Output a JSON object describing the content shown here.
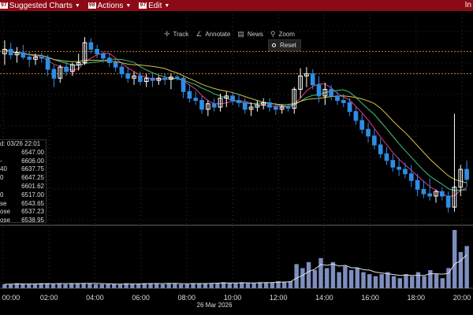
{
  "menubar": {
    "items": [
      {
        "num": "97",
        "label": "Suggested Charts"
      },
      {
        "num": "98",
        "label": "Actions"
      },
      {
        "num": "97",
        "label": "Edit"
      }
    ],
    "right_text": "In"
  },
  "toolbar": {
    "track": "Track",
    "annotate": "Annotate",
    "news": "News",
    "zoom": "Zoom",
    "reset": "Reset"
  },
  "data_panel": {
    "date_label": "d: 03/26 22:01",
    "rows": [
      {
        "label": "",
        "value": "6547.00"
      },
      {
        "label": "-",
        "value": "6606.00"
      },
      {
        "label": "40",
        "value": "6637.75"
      },
      {
        "label": "0",
        "value": "6647.25"
      },
      {
        "label": "",
        "value": "6601.62"
      },
      {
        "label": "0",
        "value": "6517.00"
      },
      {
        "label": "se",
        "value": "6543.65"
      },
      {
        "label": "ose",
        "value": "6537.23"
      },
      {
        "label": "ose",
        "value": "6538.95"
      }
    ]
  },
  "chart_data": {
    "type": "line",
    "date_label": "26 Mar 2026",
    "time_labels": [
      "00:00",
      "02:00",
      "04:00",
      "06:00",
      "08:00",
      "10:00",
      "12:00",
      "14:00",
      "16:00",
      "18:00",
      "20:00"
    ],
    "price_lines": [
      6662,
      6642
    ],
    "candles": [
      {
        "o": 6660,
        "h": 6672,
        "l": 6650,
        "c": 6664
      },
      {
        "o": 6664,
        "h": 6670,
        "l": 6655,
        "c": 6659
      },
      {
        "o": 6659,
        "h": 6666,
        "l": 6652,
        "c": 6661
      },
      {
        "o": 6661,
        "h": 6668,
        "l": 6655,
        "c": 6657
      },
      {
        "o": 6657,
        "h": 6662,
        "l": 6648,
        "c": 6655
      },
      {
        "o": 6655,
        "h": 6660,
        "l": 6650,
        "c": 6657
      },
      {
        "o": 6657,
        "h": 6661,
        "l": 6652,
        "c": 6656
      },
      {
        "o": 6656,
        "h": 6659,
        "l": 6640,
        "c": 6646
      },
      {
        "o": 6646,
        "h": 6650,
        "l": 6630,
        "c": 6638
      },
      {
        "o": 6638,
        "h": 6650,
        "l": 6634,
        "c": 6648
      },
      {
        "o": 6648,
        "h": 6654,
        "l": 6640,
        "c": 6644
      },
      {
        "o": 6644,
        "h": 6652,
        "l": 6640,
        "c": 6650
      },
      {
        "o": 6650,
        "h": 6660,
        "l": 6645,
        "c": 6652
      },
      {
        "o": 6652,
        "h": 6675,
        "l": 6650,
        "c": 6670
      },
      {
        "o": 6670,
        "h": 6674,
        "l": 6660,
        "c": 6664
      },
      {
        "o": 6664,
        "h": 6668,
        "l": 6656,
        "c": 6660
      },
      {
        "o": 6660,
        "h": 6662,
        "l": 6652,
        "c": 6656
      },
      {
        "o": 6656,
        "h": 6660,
        "l": 6648,
        "c": 6652
      },
      {
        "o": 6652,
        "h": 6655,
        "l": 6644,
        "c": 6648
      },
      {
        "o": 6648,
        "h": 6652,
        "l": 6638,
        "c": 6642
      },
      {
        "o": 6642,
        "h": 6648,
        "l": 6634,
        "c": 6638
      },
      {
        "o": 6638,
        "h": 6644,
        "l": 6632,
        "c": 6640
      },
      {
        "o": 6640,
        "h": 6644,
        "l": 6632,
        "c": 6635
      },
      {
        "o": 6635,
        "h": 6642,
        "l": 6630,
        "c": 6638
      },
      {
        "o": 6638,
        "h": 6642,
        "l": 6630,
        "c": 6636
      },
      {
        "o": 6636,
        "h": 6640,
        "l": 6632,
        "c": 6638
      },
      {
        "o": 6638,
        "h": 6642,
        "l": 6632,
        "c": 6637
      },
      {
        "o": 6637,
        "h": 6642,
        "l": 6628,
        "c": 6639
      },
      {
        "o": 6639,
        "h": 6641,
        "l": 6636,
        "c": 6638
      },
      {
        "o": 6638,
        "h": 6640,
        "l": 6620,
        "c": 6626
      },
      {
        "o": 6626,
        "h": 6632,
        "l": 6616,
        "c": 6620
      },
      {
        "o": 6620,
        "h": 6626,
        "l": 6614,
        "c": 6618
      },
      {
        "o": 6618,
        "h": 6622,
        "l": 6606,
        "c": 6610
      },
      {
        "o": 6610,
        "h": 6618,
        "l": 6604,
        "c": 6615
      },
      {
        "o": 6615,
        "h": 6620,
        "l": 6608,
        "c": 6612
      },
      {
        "o": 6612,
        "h": 6624,
        "l": 6608,
        "c": 6620
      },
      {
        "o": 6620,
        "h": 6626,
        "l": 6612,
        "c": 6622
      },
      {
        "o": 6622,
        "h": 6626,
        "l": 6614,
        "c": 6618
      },
      {
        "o": 6618,
        "h": 6624,
        "l": 6612,
        "c": 6616
      },
      {
        "o": 6616,
        "h": 6620,
        "l": 6606,
        "c": 6610
      },
      {
        "o": 6610,
        "h": 6616,
        "l": 6604,
        "c": 6612
      },
      {
        "o": 6612,
        "h": 6618,
        "l": 6608,
        "c": 6614
      },
      {
        "o": 6614,
        "h": 6620,
        "l": 6610,
        "c": 6616
      },
      {
        "o": 6616,
        "h": 6620,
        "l": 6608,
        "c": 6612
      },
      {
        "o": 6612,
        "h": 6616,
        "l": 6605,
        "c": 6610
      },
      {
        "o": 6610,
        "h": 6614,
        "l": 6606,
        "c": 6612
      },
      {
        "o": 6612,
        "h": 6615,
        "l": 6608,
        "c": 6611
      },
      {
        "o": 6611,
        "h": 6630,
        "l": 6606,
        "c": 6628
      },
      {
        "o": 6628,
        "h": 6647,
        "l": 6620,
        "c": 6640
      },
      {
        "o": 6640,
        "h": 6648,
        "l": 6630,
        "c": 6642
      },
      {
        "o": 6642,
        "h": 6646,
        "l": 6628,
        "c": 6632
      },
      {
        "o": 6632,
        "h": 6640,
        "l": 6616,
        "c": 6622
      },
      {
        "o": 6622,
        "h": 6634,
        "l": 6614,
        "c": 6628
      },
      {
        "o": 6628,
        "h": 6632,
        "l": 6618,
        "c": 6622
      },
      {
        "o": 6622,
        "h": 6626,
        "l": 6614,
        "c": 6618
      },
      {
        "o": 6618,
        "h": 6624,
        "l": 6612,
        "c": 6616
      },
      {
        "o": 6616,
        "h": 6620,
        "l": 6604,
        "c": 6608
      },
      {
        "o": 6608,
        "h": 6612,
        "l": 6596,
        "c": 6600
      },
      {
        "o": 6600,
        "h": 6606,
        "l": 6588,
        "c": 6592
      },
      {
        "o": 6592,
        "h": 6598,
        "l": 6580,
        "c": 6586
      },
      {
        "o": 6586,
        "h": 6592,
        "l": 6574,
        "c": 6578
      },
      {
        "o": 6578,
        "h": 6584,
        "l": 6566,
        "c": 6570
      },
      {
        "o": 6570,
        "h": 6576,
        "l": 6560,
        "c": 6564
      },
      {
        "o": 6564,
        "h": 6570,
        "l": 6554,
        "c": 6558
      },
      {
        "o": 6558,
        "h": 6566,
        "l": 6550,
        "c": 6556
      },
      {
        "o": 6556,
        "h": 6562,
        "l": 6548,
        "c": 6552
      },
      {
        "o": 6552,
        "h": 6560,
        "l": 6540,
        "c": 6546
      },
      {
        "o": 6546,
        "h": 6552,
        "l": 6532,
        "c": 6538
      },
      {
        "o": 6538,
        "h": 6546,
        "l": 6530,
        "c": 6534
      },
      {
        "o": 6534,
        "h": 6548,
        "l": 6528,
        "c": 6532
      },
      {
        "o": 6532,
        "h": 6538,
        "l": 6526,
        "c": 6536
      },
      {
        "o": 6536,
        "h": 6540,
        "l": 6528,
        "c": 6532
      },
      {
        "o": 6532,
        "h": 6536,
        "l": 6517,
        "c": 6522
      },
      {
        "o": 6522,
        "h": 6606,
        "l": 6518,
        "c": 6540
      },
      {
        "o": 6540,
        "h": 6560,
        "l": 6532,
        "c": 6556
      },
      {
        "o": 6556,
        "h": 6564,
        "l": 6540,
        "c": 6547
      }
    ],
    "volume": [
      4,
      4,
      5,
      4,
      4,
      4,
      5,
      5,
      4,
      5,
      4,
      5,
      5,
      5,
      5,
      4,
      4,
      4,
      4,
      4,
      5,
      4,
      4,
      5,
      5,
      5,
      4,
      5,
      5,
      4,
      4,
      5,
      5,
      5,
      5,
      5,
      6,
      5,
      5,
      6,
      5,
      5,
      6,
      6,
      6,
      7,
      6,
      7,
      24,
      20,
      26,
      18,
      30,
      20,
      26,
      16,
      22,
      18,
      20,
      16,
      14,
      12,
      14,
      16,
      12,
      10,
      14,
      12,
      16,
      12,
      18,
      14,
      10,
      20,
      58,
      36,
      42
    ]
  },
  "colors": {
    "menubar": "#8b0a15",
    "up_candle": "#ffffff",
    "down_candle": "#2f8de4",
    "ma_fast": "#e23a8e",
    "ma_mid": "#41c37a",
    "ma_slow": "#d4c24a",
    "price_line": "#d07b2a"
  }
}
